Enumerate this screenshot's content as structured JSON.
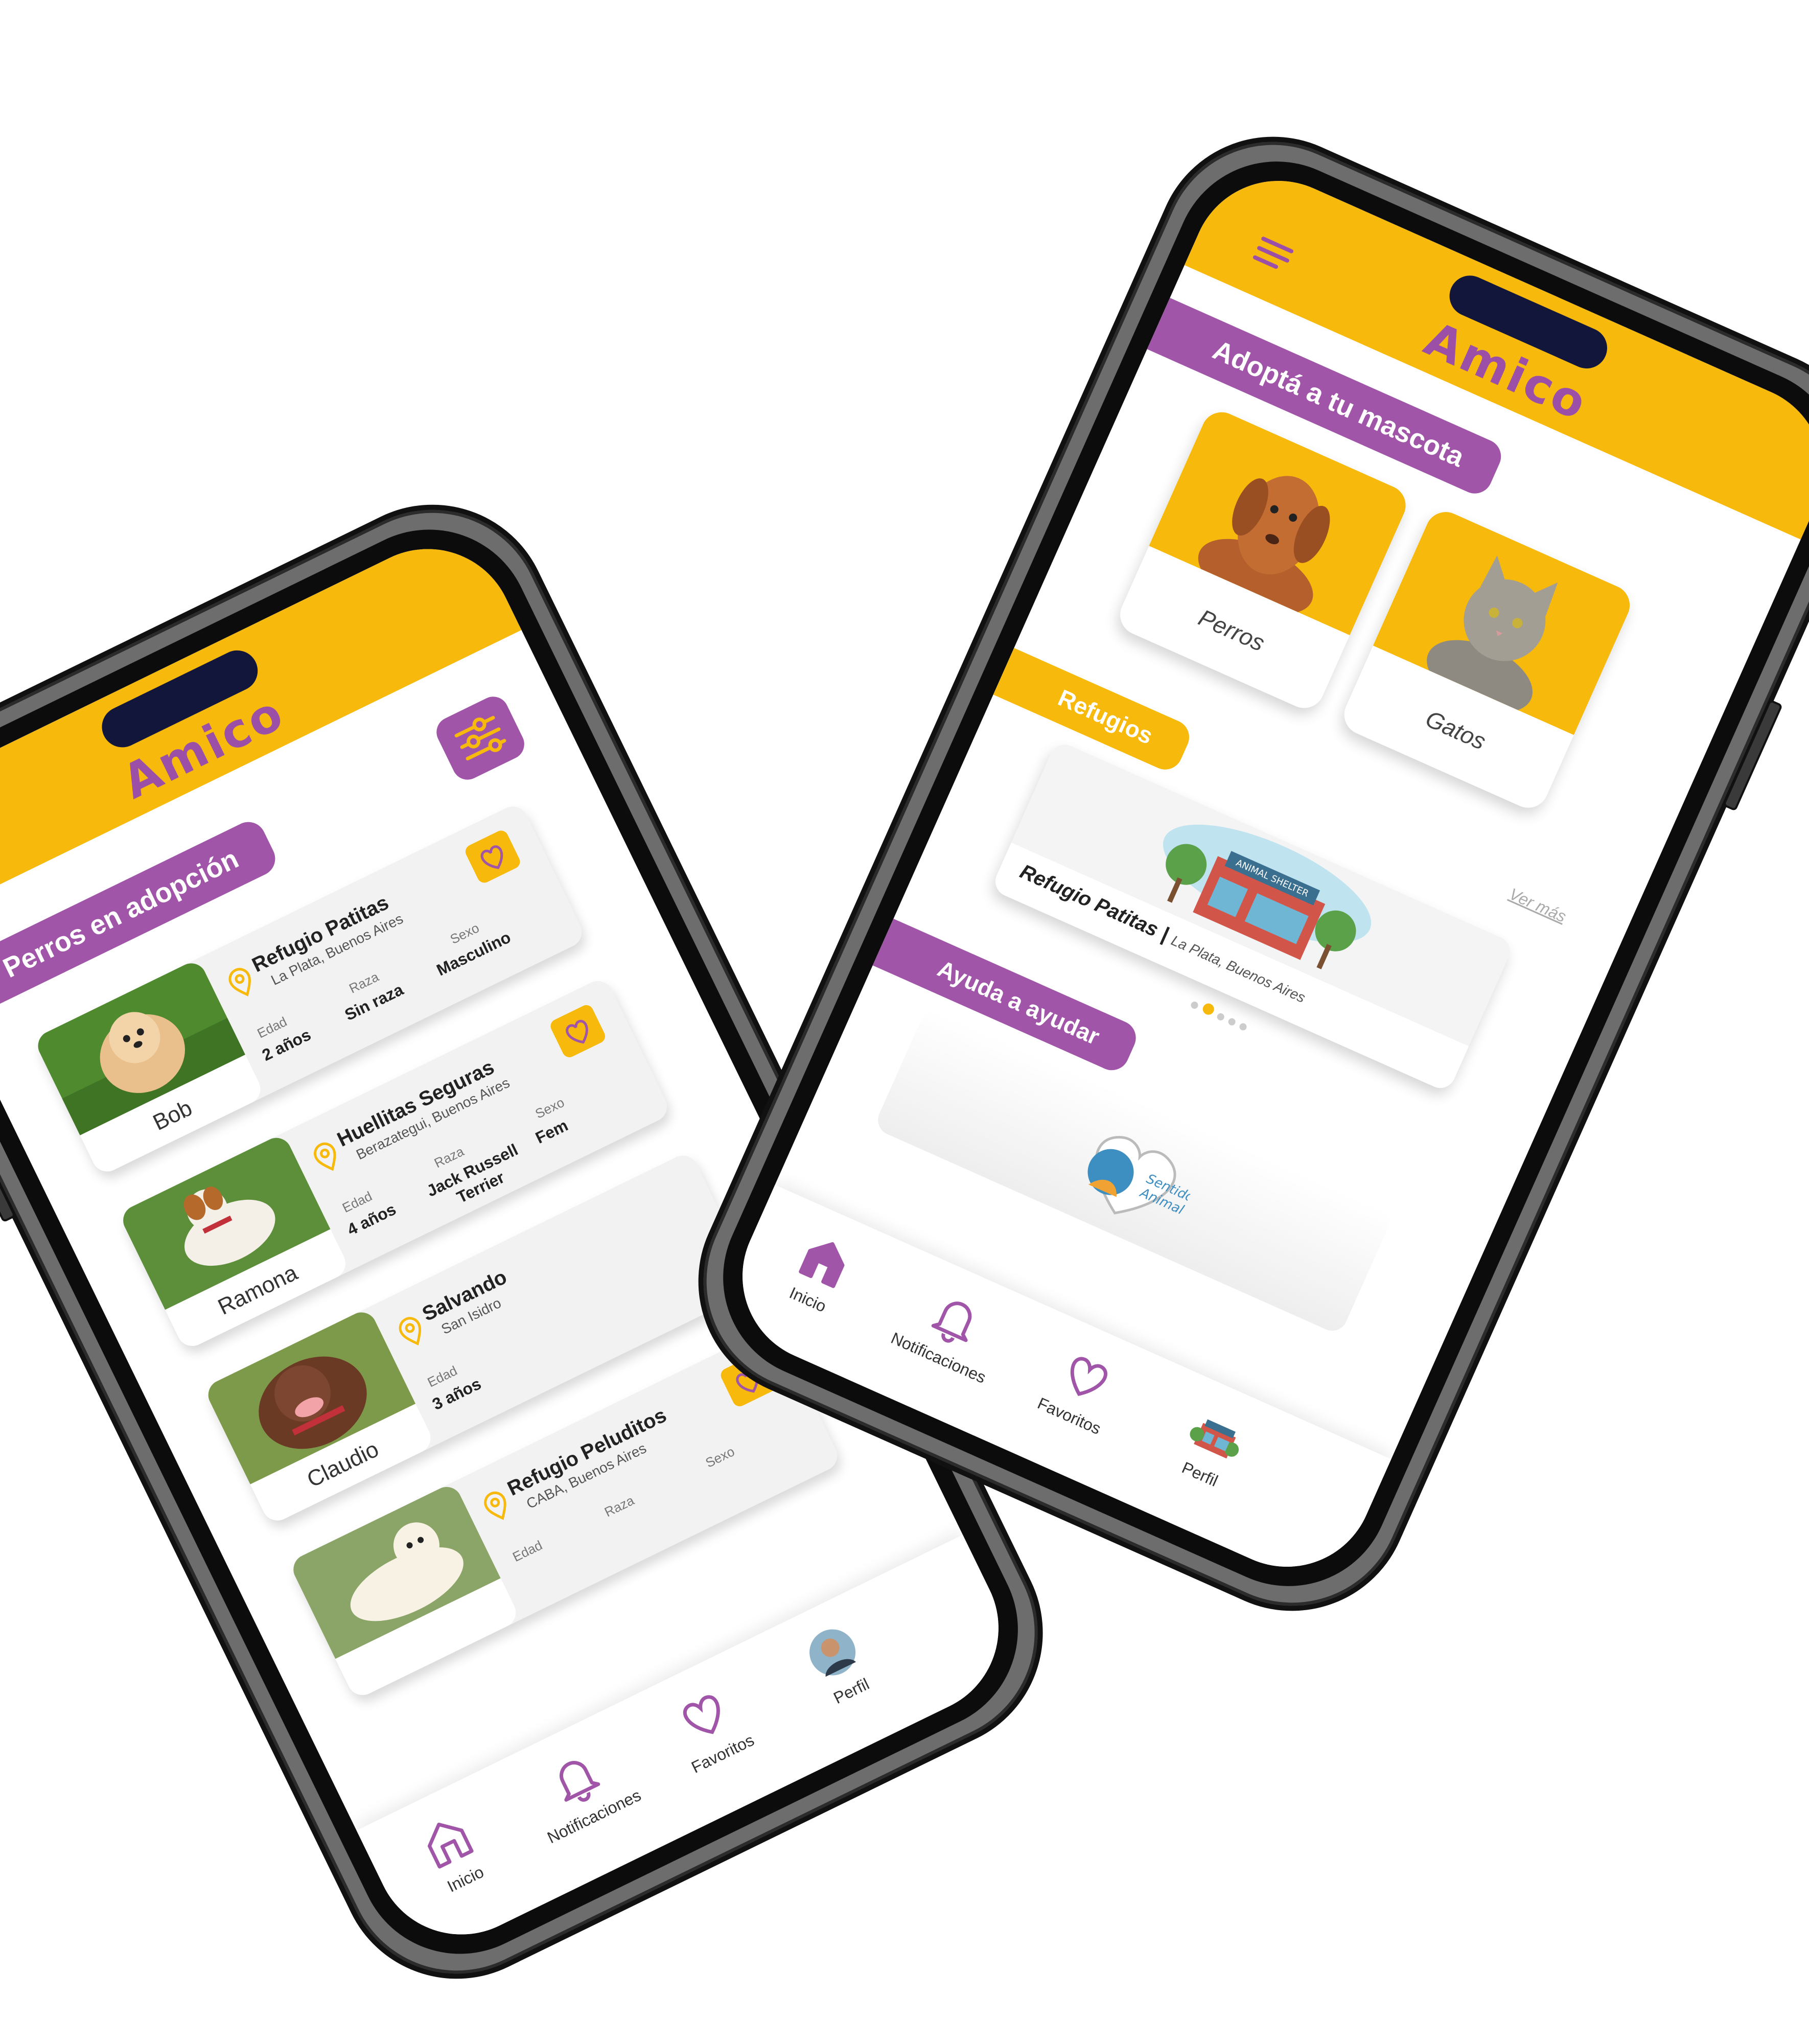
{
  "brand": {
    "logo_text": "Amico",
    "primary": "#a055a8",
    "accent": "#f6b90c"
  },
  "list_screen": {
    "title": "Perros en adopción",
    "attr_labels": {
      "age": "Edad",
      "breed": "Raza",
      "sex": "Sexo"
    },
    "pets": [
      {
        "name": "Bob",
        "shelter": "Refugio Patitas",
        "location": "La Plata, Buenos Aires",
        "age": "2 años",
        "breed": "Sin raza",
        "sex": "Masculino"
      },
      {
        "name": "Ramona",
        "shelter": "Huellitas Seguras",
        "location": "Berazategui, Buenos Aires",
        "age": "4 años",
        "breed": "Jack Russell Terrier",
        "sex": "Fem"
      },
      {
        "name": "Claudio",
        "shelter": "Salvando",
        "location": "San Isidro",
        "age": "3 años",
        "breed": "",
        "sex": ""
      },
      {
        "name": "",
        "shelter": "Refugio Peluditos",
        "location": "CABA, Buenos Aires",
        "age": "",
        "breed": "",
        "sex": ""
      }
    ],
    "nav": {
      "home": "Inicio",
      "notifications": "Notificaciones",
      "favorites": "Favoritos",
      "profile": "Perfil"
    }
  },
  "home_screen": {
    "adopt_title": "Adoptá a tu mascota",
    "categories": [
      {
        "label": "Perros"
      },
      {
        "label": "Gatos"
      }
    ],
    "shelters_title": "Refugios",
    "see_more": "Ver más",
    "featured_shelter": {
      "name": "Refugio Patitas",
      "separator": " | ",
      "location": "La Plata, Buenos Aires",
      "sign": "ANIMAL SHELTER"
    },
    "help_title": "Ayuda a ayudar",
    "help_logo": {
      "line1": "Sentido",
      "line2": "Animal"
    },
    "nav": {
      "home": "Inicio",
      "notifications": "Notificaciones",
      "favorites": "Favoritos",
      "profile": "Perfil"
    }
  }
}
